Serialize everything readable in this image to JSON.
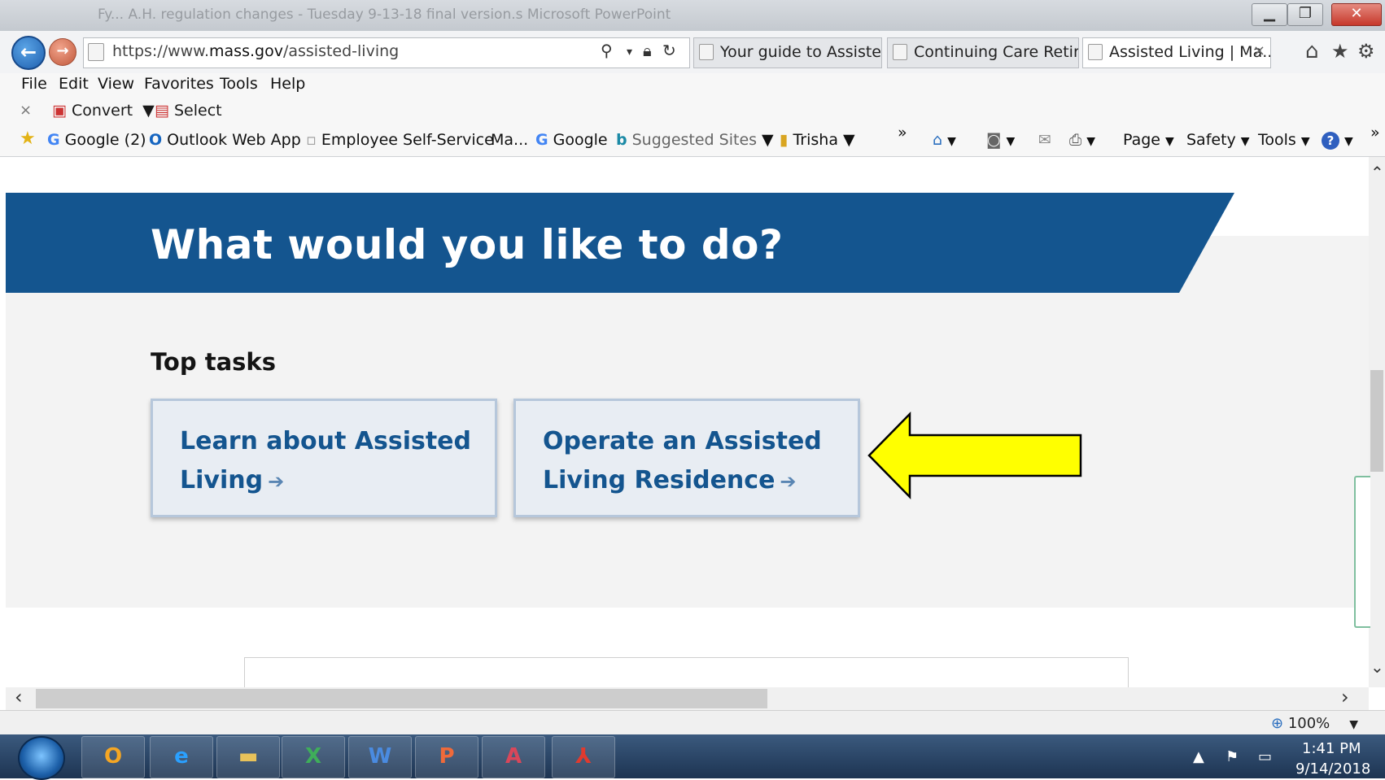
{
  "browser": {
    "title": "Fy... A.H. regulation changes - Tuesday 9-13-18 final version.s Microsoft PowerPoint",
    "url_prefix": "https://www.",
    "url_host": "mass.gov",
    "url_path": "/assisted-living",
    "tabs": [
      {
        "label": "Your guide to Assiste..."
      },
      {
        "label": "Continuing Care Retire..."
      },
      {
        "label": "Assisted Living | Ma..."
      }
    ],
    "tab_close": "×"
  },
  "menu": [
    "File",
    "Edit",
    "View",
    "Favorites",
    "Tools",
    "Help"
  ],
  "convert_bar": {
    "close": "×",
    "convert": "Convert",
    "select": "Select"
  },
  "favorites": {
    "google2": "Google (2)",
    "outlook": "Outlook Web App",
    "ess": "Employee Self-Service",
    "ma": "Ma...",
    "google": "Google",
    "suggested": "Suggested Sites",
    "trisha": "Trisha",
    "more": "»"
  },
  "command_bar": {
    "page": "Page",
    "safety": "Safety",
    "tools": "Tools",
    "more": "»"
  },
  "page": {
    "banner_title": "What would you like to do?",
    "section_heading": "Top tasks",
    "cards": [
      {
        "line1": "Learn about Assisted",
        "line2": "Living"
      },
      {
        "line1": "Operate an Assisted",
        "line2": "Living Residence"
      }
    ],
    "arrow_color": "#ffff00"
  },
  "status": {
    "zoom": "100%"
  },
  "taskbar": {
    "time": "1:41 PM",
    "date": "9/14/2018",
    "apps": [
      "Outlook",
      "Internet Explorer",
      "File Explorer",
      "Excel",
      "Word",
      "PowerPoint",
      "Access",
      "Acrobat"
    ]
  },
  "colors": {
    "banner": "#14558f",
    "card_text": "#14558f",
    "card_bg": "#e8edf3"
  }
}
